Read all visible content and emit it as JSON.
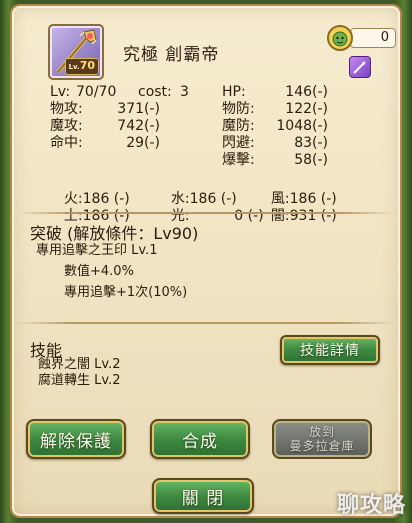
{
  "card": {
    "name": "究極 創霸帝",
    "level_badge": "70",
    "level_badge_prefix": "Lv."
  },
  "currency": {
    "value": "0"
  },
  "stats": {
    "lv_label": "Lv:",
    "lv_value": "70/70",
    "cost_label": "cost:",
    "cost_value": "3",
    "hp_label": "HP:",
    "hp_value": "146(-)",
    "left": [
      {
        "label": "物攻:",
        "value": "371(-)"
      },
      {
        "label": "魔攻:",
        "value": "742(-)"
      },
      {
        "label": "命中:",
        "value": "29(-)"
      }
    ],
    "right": [
      {
        "label": "物防:",
        "value": "122(-)"
      },
      {
        "label": "魔防:",
        "value": "1048(-)"
      },
      {
        "label": "閃避:",
        "value": "83(-)"
      },
      {
        "label": "爆擊:",
        "value": "58(-)"
      }
    ]
  },
  "elements": {
    "row1": [
      {
        "label": "火:",
        "value": "186 (-)"
      },
      {
        "label": "水:",
        "value": "186 (-)"
      },
      {
        "label": "風:",
        "value": "186 (-)"
      }
    ],
    "row2": [
      {
        "label": "土:",
        "value": "186 (-)"
      },
      {
        "label": "光:",
        "value": "0 (-)"
      },
      {
        "label": "闇:",
        "value": "931 (-)"
      }
    ]
  },
  "breakthrough": {
    "title": "突破 (解放條件：Lv90)",
    "skill": "專用追擊之王印 Lv.1",
    "effect1": "數值+4.0%",
    "effect2": "專用追擊+1次(10%)"
  },
  "skills": {
    "title": "技能",
    "items": [
      "蝕界之闇 Lv.2",
      "腐道轉生 Lv.2"
    ],
    "detail_button": "技能詳情"
  },
  "actions": {
    "release": "解除保護",
    "combine": "合成",
    "store_line1": "放到",
    "store_line2": "曼多拉倉庫",
    "close": "關 閉"
  },
  "watermark": "聊攻略"
}
